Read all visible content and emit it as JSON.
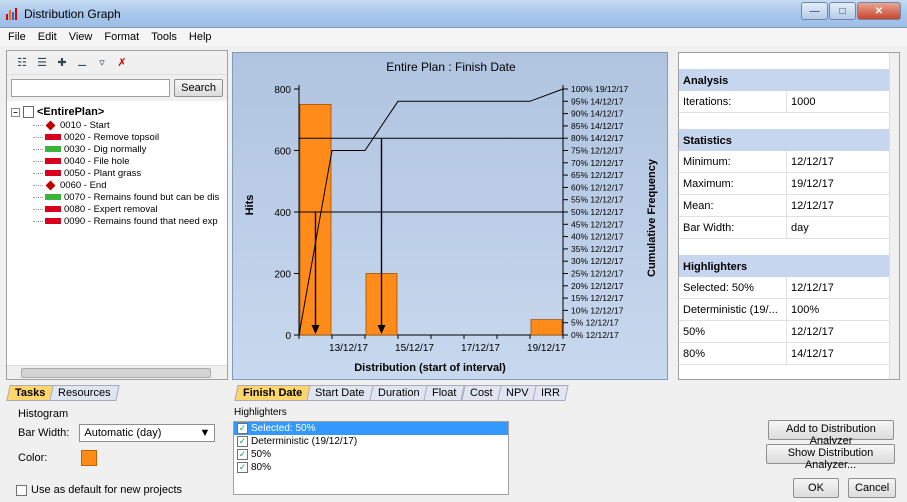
{
  "window": {
    "title": "Distribution Graph"
  },
  "menu": [
    "File",
    "Edit",
    "View",
    "Format",
    "Tools",
    "Help"
  ],
  "search": {
    "button_label": "Search",
    "value": ""
  },
  "tree": {
    "root": "<EntirePlan>",
    "items": [
      {
        "label": "0010 - Start",
        "type": "milestone"
      },
      {
        "label": "0020 - Remove topsoil",
        "type": "red"
      },
      {
        "label": "0030 - Dig normally",
        "type": "green"
      },
      {
        "label": "0040 - File hole",
        "type": "red"
      },
      {
        "label": "0050 - Plant grass",
        "type": "red"
      },
      {
        "label": "0060 - End",
        "type": "milestone"
      },
      {
        "label": "0070 - Remains found but can be dis",
        "type": "green"
      },
      {
        "label": "0080 - Expert removal",
        "type": "red"
      },
      {
        "label": "0090 - Remains found that need exp",
        "type": "red"
      }
    ]
  },
  "chart_data": {
    "type": "bar",
    "title": "Entire Plan : Finish Date",
    "xlabel": "Distribution (start of interval)",
    "ylabel": "Hits",
    "y2label": "Cumulative Frequency",
    "bar_color": "#ff8c1a",
    "ylim": [
      0,
      800
    ],
    "yticks": [
      0,
      200,
      400,
      600,
      800
    ],
    "x_ticks": [
      "13/12/17",
      "15/12/17",
      "17/12/17",
      "19/12/17"
    ],
    "bars": [
      {
        "start": "12/12/17",
        "value": 750
      },
      {
        "start": "14/12/17",
        "value": 200
      },
      {
        "start": "19/12/17",
        "value": 50
      }
    ],
    "cumulative_labels": [
      "0% 12/12/17",
      "5% 12/12/17",
      "10% 12/12/17",
      "15% 12/12/17",
      "20% 12/12/17",
      "25% 12/12/17",
      "30% 12/12/17",
      "35% 12/12/17",
      "40% 12/12/17",
      "45% 12/12/17",
      "50% 12/12/17",
      "55% 12/12/17",
      "60% 12/12/17",
      "65% 12/12/17",
      "70% 12/12/17",
      "75% 12/12/17",
      "80% 14/12/17",
      "85% 14/12/17",
      "90% 14/12/17",
      "95% 14/12/17",
      "100% 19/12/17"
    ],
    "cumulative_curve": [
      {
        "x": "12/12/17",
        "pct": 0
      },
      {
        "x": "13/12/17",
        "pct": 75
      },
      {
        "x": "14/12/17",
        "pct": 75
      },
      {
        "x": "15/12/17",
        "pct": 95
      },
      {
        "x": "19/12/17",
        "pct": 95
      },
      {
        "x": "20/12/17",
        "pct": 100
      }
    ],
    "highlights": [
      {
        "label": "50%",
        "pct": 50,
        "x": "12/12/17"
      },
      {
        "label": "80%",
        "pct": 80,
        "x": "14/12/17"
      }
    ]
  },
  "analysis": {
    "heading": "Analysis",
    "rows": [
      {
        "k": "Iterations:",
        "v": "1000"
      }
    ]
  },
  "statistics": {
    "heading": "Statistics",
    "rows": [
      {
        "k": "Minimum:",
        "v": "12/12/17"
      },
      {
        "k": "Maximum:",
        "v": "19/12/17"
      },
      {
        "k": "Mean:",
        "v": "12/12/17"
      },
      {
        "k": "Bar Width:",
        "v": "day"
      }
    ]
  },
  "highlighters_panel": {
    "heading": "Highlighters",
    "rows": [
      {
        "k": "Selected: 50%",
        "v": "12/12/17"
      },
      {
        "k": "Deterministic (19/...",
        "v": "100%"
      },
      {
        "k": "50%",
        "v": "12/12/17"
      },
      {
        "k": "80%",
        "v": "14/12/17"
      }
    ]
  },
  "left_tabs": [
    {
      "label": "Tasks",
      "active": true
    },
    {
      "label": "Resources",
      "active": false
    }
  ],
  "main_tabs": [
    {
      "label": "Finish Date",
      "active": true
    },
    {
      "label": "Start Date",
      "active": false
    },
    {
      "label": "Duration",
      "active": false
    },
    {
      "label": "Float",
      "active": false
    },
    {
      "label": "Cost",
      "active": false
    },
    {
      "label": "NPV",
      "active": false
    },
    {
      "label": "IRR",
      "active": false
    }
  ],
  "histogram": {
    "group_label": "Histogram",
    "bar_width_label": "Bar Width:",
    "bar_width_value": "Automatic (day)",
    "color_label": "Color:",
    "color": "#ff8c1a",
    "default_label": "Use as default for new projects"
  },
  "highlighters_list": {
    "label": "Highlighters",
    "items": [
      {
        "label": "Selected: 50%",
        "checked": true,
        "selected": true
      },
      {
        "label": "Deterministic (19/12/17)",
        "checked": true,
        "selected": false
      },
      {
        "label": "50%",
        "checked": true,
        "selected": false
      },
      {
        "label": "80%",
        "checked": true,
        "selected": false
      }
    ]
  },
  "buttons": {
    "add": "Add to Distribution Analyzer",
    "show": "Show Distribution Analyzer...",
    "ok": "OK",
    "cancel": "Cancel"
  }
}
